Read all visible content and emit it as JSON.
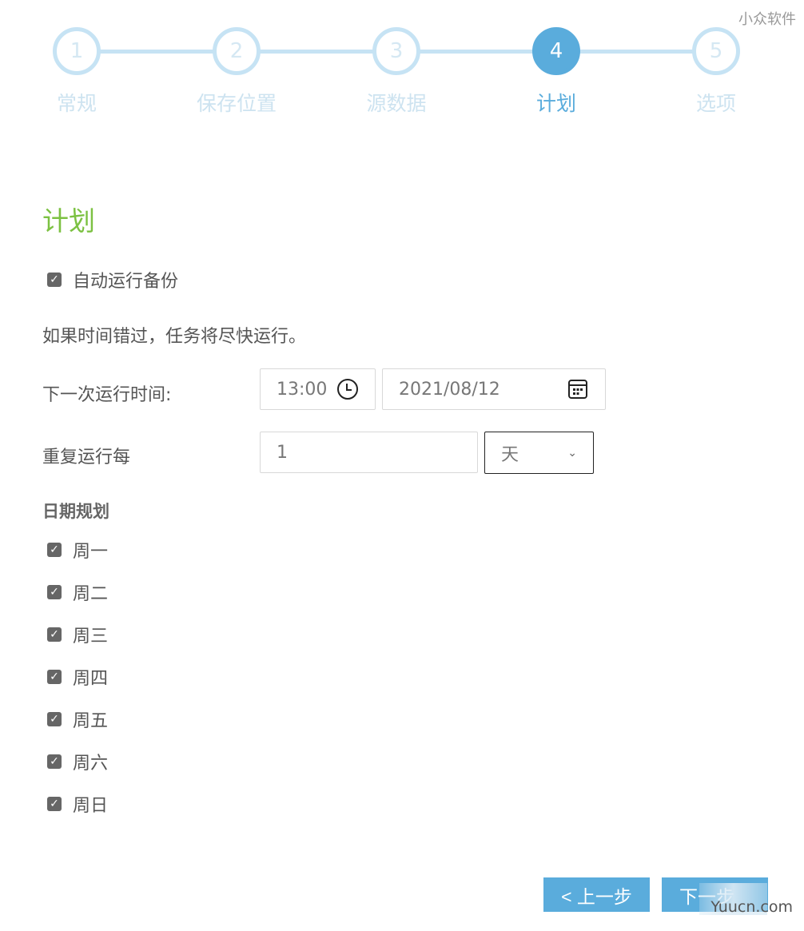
{
  "watermark_top": "小众软件",
  "watermark_bottom": "Yuucn.com",
  "steps": [
    {
      "num": "1",
      "label": "常规"
    },
    {
      "num": "2",
      "label": "保存位置"
    },
    {
      "num": "3",
      "label": "源数据"
    },
    {
      "num": "4",
      "label": "计划",
      "active": true
    },
    {
      "num": "5",
      "label": "选项"
    }
  ],
  "title": "计划",
  "auto_run": {
    "label": "自动运行备份",
    "checked": true
  },
  "note": "如果时间错过，任务将尽快运行。",
  "next_run": {
    "label": "下一次运行时间:",
    "time": "13:00",
    "date": "2021/08/12",
    "time_icon": "clock-icon",
    "date_icon": "calendar-icon"
  },
  "repeat": {
    "label": "重复运行每",
    "value": "1",
    "unit": "天"
  },
  "schedule": {
    "heading": "日期规划",
    "days": [
      {
        "label": "周一",
        "checked": true
      },
      {
        "label": "周二",
        "checked": true
      },
      {
        "label": "周三",
        "checked": true
      },
      {
        "label": "周四",
        "checked": true
      },
      {
        "label": "周五",
        "checked": true
      },
      {
        "label": "周六",
        "checked": true
      },
      {
        "label": "周日",
        "checked": true
      }
    ]
  },
  "buttons": {
    "prev": "< 上一步",
    "next": "下一步"
  },
  "colors": {
    "accent": "#5aacdc",
    "title": "#7cc142",
    "inactive_step": "#c6e3f4"
  }
}
